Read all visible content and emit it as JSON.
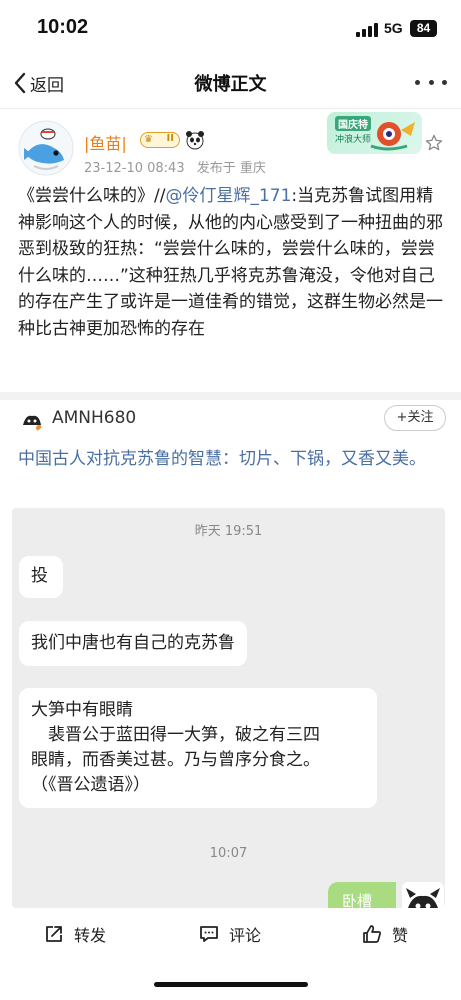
{
  "status_bar": {
    "time": "10:02",
    "network": "5G",
    "battery": "84"
  },
  "nav": {
    "back_label": "返回",
    "title": "微博正文"
  },
  "post": {
    "author": "|鱼苗|",
    "vip_level": "II",
    "date": "23-12-10 08:43",
    "source": "发布于 重庆",
    "body_prefix": "《尝尝什么味的》//",
    "mention": "@伶仃星辉_171",
    "body_rest": ":当克苏鲁试图用精神影响这个人的时候，从他的内心感受到了一种扭曲的邪恶到极致的狂热：“尝尝什么味的，尝尝什么味的，尝尝什么味的……”这种狂热几乎将克苏鲁淹没，令他对自己的存在产生了或许是一道佳肴的错觉，这群生物必然是一种比古神更加恐怖的存在"
  },
  "comment": {
    "author": "AMNH680",
    "follow_label": "+关注",
    "text": "中国古人对抗克苏鲁的智慧：切片、下锅，又香又美。"
  },
  "chat_screenshot": {
    "time1": "昨天 19:51",
    "msg1": "投",
    "msg2": "我们中唐也有自己的克苏鲁",
    "msg3_line1": "大笋中有眼睛",
    "msg3_line2": "　裴晋公于蓝田得一大笋，破之有三四",
    "msg3_line3": "眼睛，而香美过甚。乃与曾序分食之。",
    "msg3_line4": "（《晋公遗语》）",
    "time2": "10:07",
    "reply": "卧槽"
  },
  "bottom_bar": {
    "repost": "转发",
    "comment": "评论",
    "like": "赞"
  }
}
